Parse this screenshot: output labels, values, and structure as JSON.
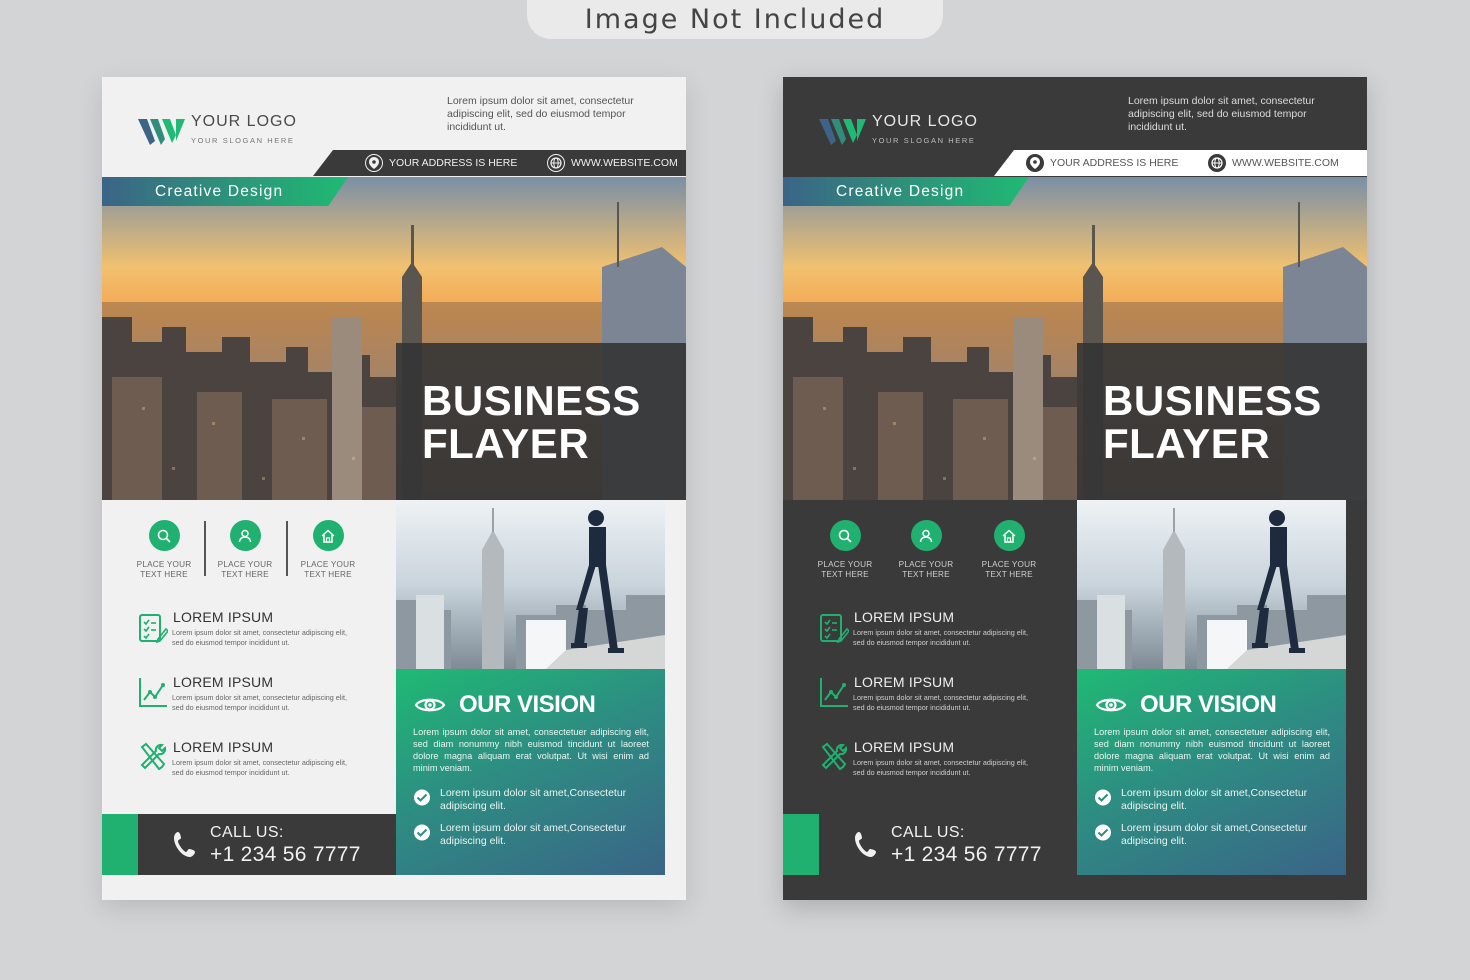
{
  "notice": "Image Not Included",
  "colors": {
    "accent": "#20b070",
    "dark": "#3a3a3a",
    "light": "#f1f1f1",
    "blue": "#3b6487"
  },
  "flyers": [
    {
      "variant": "light",
      "logo": {
        "title": "YOUR LOGO",
        "slogan": "YOUR SLOGAN HERE",
        "icon": "w-logo-icon"
      },
      "top_text": "Lorem ipsum dolor sit amet, consectetur adipiscing elit, sed do eiusmod tempor incididunt ut.",
      "address": "YOUR ADDRESS IS HERE",
      "website": "WWW.WEBSITE.COM",
      "tagline": "Creative Design",
      "title_line1": "BUSINESS",
      "title_line2": "FLAYER",
      "features": [
        {
          "icon": "search-icon",
          "line1": "PLACE YOUR",
          "line2": "TEXT HERE"
        },
        {
          "icon": "user-icon",
          "line1": "PLACE YOUR",
          "line2": "TEXT HERE"
        },
        {
          "icon": "home-icon",
          "line1": "PLACE YOUR",
          "line2": "TEXT HERE"
        }
      ],
      "items": [
        {
          "icon": "checklist-icon",
          "title": "LOREM IPSUM",
          "text": "Lorem ipsum dolor sit amet, consectetur adipiscing elit, sed do eiusmod tempor incididunt ut."
        },
        {
          "icon": "chart-icon",
          "title": "LOREM IPSUM",
          "text": "Lorem ipsum dolor sit amet, consectetur adipiscing elit, sed do eiusmod tempor incididunt ut."
        },
        {
          "icon": "tools-icon",
          "title": "LOREM IPSUM",
          "text": "Lorem ipsum dolor sit amet, consectetur adipiscing elit, sed do eiusmod tempor incididunt ut."
        }
      ],
      "call_label": "CALL US:",
      "call_number": "+1 234 56 7777",
      "vision_title": "OUR VISION",
      "vision_text": "Lorem ipsum dolor sit amet, consectetuer adipiscing elit, sed diam nonummy nibh euismod tincidunt ut laoreet dolore magna aliquam erat volutpat. Ut wisi enim ad minim veniam.",
      "checks": [
        "Lorem ipsum dolor sit amet,Consectetur adipiscing elit.",
        "Lorem ipsum dolor sit amet,Consectetur adipiscing elit."
      ]
    },
    {
      "variant": "dark",
      "logo": {
        "title": "YOUR LOGO",
        "slogan": "YOUR SLOGAN HERE",
        "icon": "w-logo-icon"
      },
      "top_text": "Lorem ipsum dolor sit amet, consectetur adipiscing elit, sed do eiusmod tempor incididunt ut.",
      "address": "YOUR ADDRESS IS HERE",
      "website": "WWW.WEBSITE.COM",
      "tagline": "Creative Design",
      "title_line1": "BUSINESS",
      "title_line2": "FLAYER",
      "features": [
        {
          "icon": "search-icon",
          "line1": "PLACE YOUR",
          "line2": "TEXT HERE"
        },
        {
          "icon": "user-icon",
          "line1": "PLACE YOUR",
          "line2": "TEXT HERE"
        },
        {
          "icon": "home-icon",
          "line1": "PLACE YOUR",
          "line2": "TEXT HERE"
        }
      ],
      "items": [
        {
          "icon": "checklist-icon",
          "title": "LOREM IPSUM",
          "text": "Lorem ipsum dolor sit amet, consectetur adipiscing elit, sed do eiusmod tempor incididunt ut."
        },
        {
          "icon": "chart-icon",
          "title": "LOREM IPSUM",
          "text": "Lorem ipsum dolor sit amet, consectetur adipiscing elit, sed do eiusmod tempor incididunt ut."
        },
        {
          "icon": "tools-icon",
          "title": "LOREM IPSUM",
          "text": "Lorem ipsum dolor sit amet, consectetur adipiscing elit, sed do eiusmod tempor incididunt ut."
        }
      ],
      "call_label": "CALL US:",
      "call_number": "+1 234 56 7777",
      "vision_title": "OUR VISION",
      "vision_text": "Lorem ipsum dolor sit amet, consectetuer adipiscing elit, sed diam nonummy nibh euismod tincidunt ut laoreet dolore magna aliquam erat volutpat. Ut wisi enim ad minim veniam.",
      "checks": [
        "Lorem ipsum dolor sit amet,Consectetur adipiscing elit.",
        "Lorem ipsum dolor sit amet,Consectetur adipiscing elit."
      ]
    }
  ]
}
